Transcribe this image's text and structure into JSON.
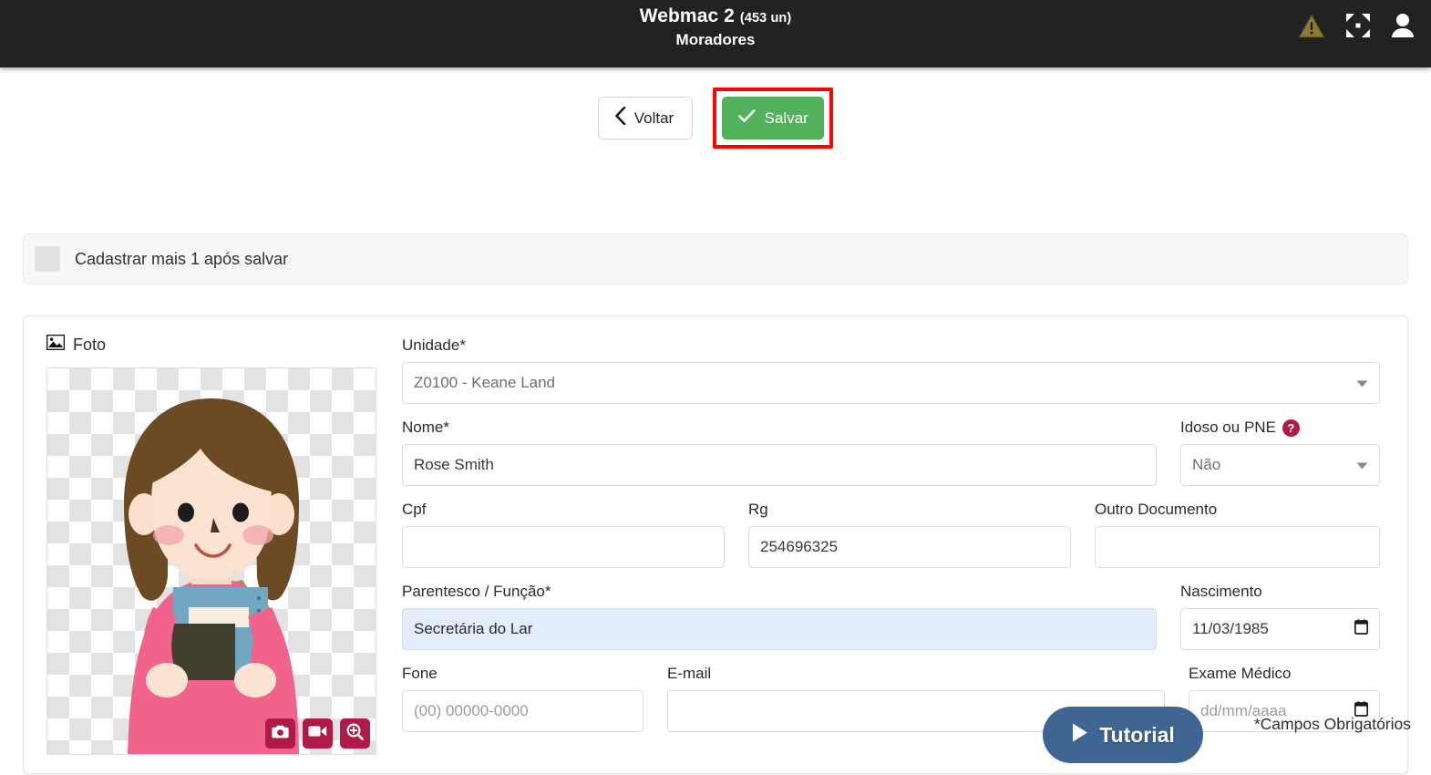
{
  "header": {
    "app_title": "Webmac 2",
    "unit_count": "(453 un)",
    "section_title": "Moradores",
    "icons": {
      "warning": "warning-triangle-icon",
      "fullscreen": "fullscreen-expand-icon",
      "user": "user-person-icon"
    },
    "bg_color": "#222222"
  },
  "actions": {
    "back_label": "Voltar",
    "save_label": "Salvar",
    "save_color": "#52b25b",
    "highlight_color": "#ff0000"
  },
  "options_strip": {
    "checkbox_label": "Cadastrar mais 1 após salvar",
    "checked": false
  },
  "photo": {
    "section_label": "Foto",
    "buttons": [
      {
        "name": "camera-button",
        "icon": "camera-icon"
      },
      {
        "name": "video-button",
        "icon": "video-camera-icon"
      },
      {
        "name": "zoom-button",
        "icon": "magnifier-plus-icon"
      }
    ],
    "button_color": "#b01a48"
  },
  "form": {
    "unidade": {
      "label": "Unidade*",
      "value": "Z0100 - Keane Land"
    },
    "nome": {
      "label": "Nome*",
      "value": "Rose Smith"
    },
    "idoso_pne": {
      "label": "Idoso ou PNE",
      "help_icon": "question-mark-icon",
      "value": "Não"
    },
    "cpf": {
      "label": "Cpf",
      "value": ""
    },
    "rg": {
      "label": "Rg",
      "value": "254696325"
    },
    "outro_documento": {
      "label": "Outro Documento",
      "value": ""
    },
    "parentesco": {
      "label": "Parentesco / Função*",
      "value": "Secretária do Lar"
    },
    "nascimento": {
      "label": "Nascimento",
      "value": "11/03/1985"
    },
    "fone": {
      "label": "Fone",
      "value": "",
      "placeholder": "(00) 00000-0000"
    },
    "email": {
      "label": "E-mail",
      "value": ""
    },
    "exame_medico": {
      "label": "Exame Médico",
      "value": "",
      "placeholder": "dd/mm/aaaa"
    }
  },
  "footer": {
    "tutorial_label": "Tutorial",
    "tutorial_color": "#3f6592",
    "required_note": "*Campos Obrigatórios"
  }
}
